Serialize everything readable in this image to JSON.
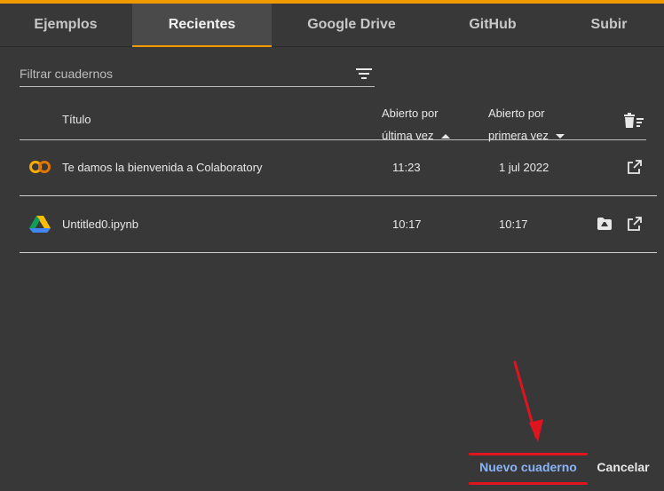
{
  "tabs": [
    {
      "label": "Ejemplos"
    },
    {
      "label": "Recientes"
    },
    {
      "label": "Google Drive"
    },
    {
      "label": "GitHub"
    },
    {
      "label": "Subir"
    }
  ],
  "active_tab": "Recientes",
  "filter": {
    "placeholder": "Filtrar cuadernos"
  },
  "table": {
    "headers": {
      "title": "Título",
      "last_line1": "Abierto por",
      "last_line2": "última vez",
      "first_line1": "Abierto por",
      "first_line2": "primera vez"
    },
    "rows": [
      {
        "name": "Te damos la bienvenida a Colaboratory",
        "last_opened": "11:23",
        "first_opened": "1 jul 2022",
        "icon": "colab-icon"
      },
      {
        "name": "Untitled0.ipynb",
        "last_opened": "10:17",
        "first_opened": "10:17",
        "icon": "google-drive-icon"
      }
    ]
  },
  "buttons": {
    "new_notebook": "Nuevo cuaderno",
    "cancel": "Cancelar"
  },
  "colors": {
    "accent": "#f29900",
    "link": "#8ab4f8",
    "annotation": "#e0141e",
    "background": "#383838"
  }
}
